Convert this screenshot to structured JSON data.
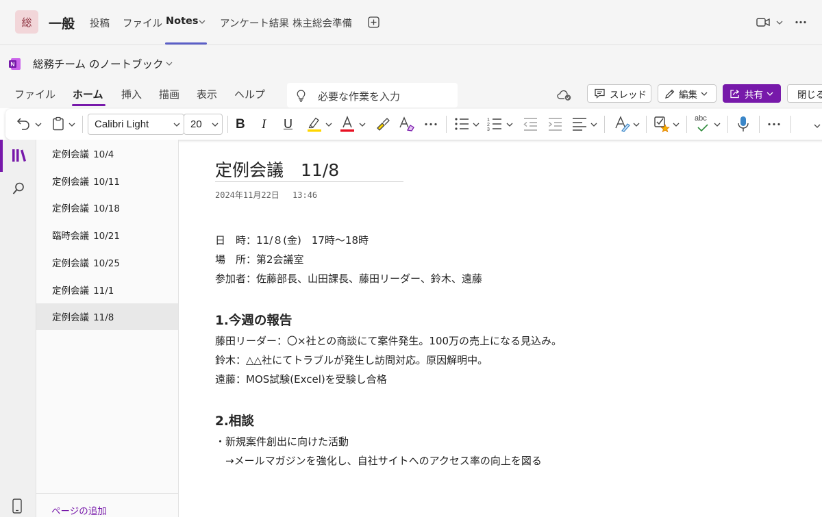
{
  "teams": {
    "avatar_initial": "総",
    "channel_name": "一般",
    "tabs": [
      "投稿",
      "ファイル",
      "Notes",
      "アンケート結果",
      "株主総会準備"
    ],
    "active_tab": "Notes"
  },
  "notebook": {
    "title": "総務チーム のノートブック"
  },
  "ribbon": {
    "tabs": [
      "ファイル",
      "ホーム",
      "挿入",
      "描画",
      "表示",
      "ヘルプ"
    ],
    "active_tab": "ホーム",
    "search_placeholder": "必要な作業を入力",
    "thread_label": "スレッド",
    "edit_label": "編集",
    "share_label": "共有",
    "close_label": "閉じる"
  },
  "toolbar": {
    "font_name": "Calibri Light",
    "font_size": "20",
    "bold": "B",
    "italic": "I",
    "underline": "U",
    "highlight_color": "#ffd600",
    "font_color": "#e81123",
    "spell_label": "abc"
  },
  "pages": [
    "定例会議\t10/4",
    "定例会議\t10/11",
    "定例会議\t10/18",
    "臨時会議\t10/21",
    "定例会議\t10/25",
    "定例会議\t11/1",
    "定例会議\t11/8"
  ],
  "selected_page_index": 6,
  "add_page_label": "ページの追加",
  "page": {
    "title": "定例会議　11/8",
    "date": "2024年11月22日　 13:46",
    "info_lines": [
      "日　時：11/８(金)　17時～18時",
      "場　所：第2会議室",
      "参加者：佐藤部長、山田課長、藤田リーダー、鈴木、遠藤"
    ],
    "section1_heading": "1.今週の報告",
    "section1_lines": [
      "藤田リーダー：〇×社との商談にて案件発生。100万の売上になる見込み。",
      "鈴木：△△社にてトラブルが発生し訪問対応。原因解明中。",
      "遠藤：MOS試験(Excel)を受験し合格"
    ],
    "section2_heading": "2.相談",
    "section2_lines": [
      "・新規案件創出に向けた活動",
      "　→メールマガジンを強化し、自社サイトへのアクセス率の向上を図る"
    ]
  },
  "colors": {
    "onenote_purple": "#7719aa",
    "teams_accent": "#5b5fc7"
  }
}
